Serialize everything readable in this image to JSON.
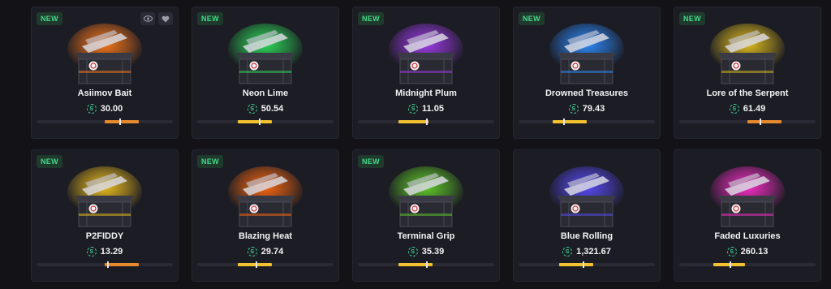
{
  "badge_new_label": "NEW",
  "icons": {
    "preview": "eye-icon",
    "favorite": "heart-icon",
    "currency": "coin-icon"
  },
  "cases": [
    {
      "name": "Asiimov Bait",
      "price": "30.00",
      "is_new": true,
      "show_actions": true,
      "glow": "#ff7a1a",
      "range_color": "#e68a2e",
      "range_start": 0.5,
      "range_end": 0.75,
      "marker": 0.61
    },
    {
      "name": "Neon Lime",
      "price": "50.54",
      "is_new": true,
      "show_actions": false,
      "glow": "#2ee05a",
      "range_color": "#f2c230",
      "range_start": 0.3,
      "range_end": 0.55,
      "marker": 0.45
    },
    {
      "name": "Midnight Plum",
      "price": "11.05",
      "is_new": true,
      "show_actions": false,
      "glow": "#a23cf0",
      "range_color": "#f2c230",
      "range_start": 0.3,
      "range_end": 0.52,
      "marker": 0.5
    },
    {
      "name": "Drowned Treasures",
      "price": "79.43",
      "is_new": true,
      "show_actions": false,
      "glow": "#2c8cff",
      "range_color": "#f2c230",
      "range_start": 0.25,
      "range_end": 0.5,
      "marker": 0.33
    },
    {
      "name": "Lore of the Serpent",
      "price": "61.49",
      "is_new": true,
      "show_actions": false,
      "glow": "#e6c21c",
      "range_color": "#e68a2e",
      "range_start": 0.5,
      "range_end": 0.75,
      "marker": 0.59
    },
    {
      "name": "P2FIDDY",
      "price": "13.29",
      "is_new": true,
      "show_actions": false,
      "glow": "#f2c21c",
      "range_color": "#e68a2e",
      "range_start": 0.5,
      "range_end": 0.75,
      "marker": 0.52
    },
    {
      "name": "Blazing Heat",
      "price": "29.74",
      "is_new": true,
      "show_actions": false,
      "glow": "#ff6a10",
      "range_color": "#f2c230",
      "range_start": 0.3,
      "range_end": 0.55,
      "marker": 0.43
    },
    {
      "name": "Terminal Grip",
      "price": "35.39",
      "is_new": true,
      "show_actions": false,
      "glow": "#62d12a",
      "range_color": "#f2c230",
      "range_start": 0.3,
      "range_end": 0.55,
      "marker": 0.5
    },
    {
      "name": "Blue Rolling",
      "price": "1,321.67",
      "is_new": false,
      "show_actions": false,
      "glow": "#5a4dff",
      "range_color": "#f2c230",
      "range_start": 0.3,
      "range_end": 0.55,
      "marker": 0.47
    },
    {
      "name": "Faded Luxuries",
      "price": "260.13",
      "is_new": false,
      "show_actions": false,
      "glow": "#ff2ecb",
      "range_color": "#f2c230",
      "range_start": 0.25,
      "range_end": 0.48,
      "marker": 0.37
    }
  ]
}
